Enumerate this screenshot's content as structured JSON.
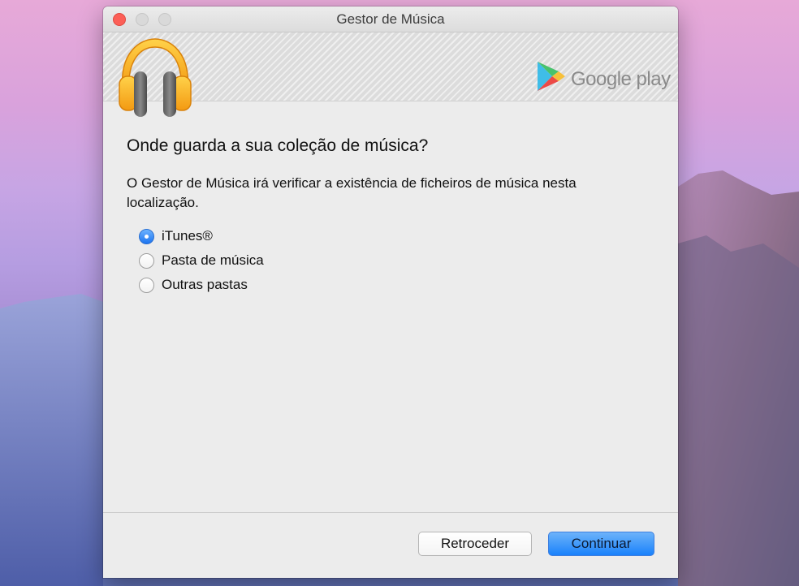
{
  "window": {
    "title": "Gestor de Música"
  },
  "banner": {
    "brand_text": "Google play",
    "app_icon": "headphones-icon",
    "brand_icon": "google-play-icon"
  },
  "content": {
    "heading": "Onde guarda a sua coleção de música?",
    "description": "O Gestor de Música irá verificar a existência de ficheiros de música nesta localização.",
    "options": [
      {
        "label": "iTunes®",
        "selected": true
      },
      {
        "label": "Pasta de música",
        "selected": false
      },
      {
        "label": "Outras pastas",
        "selected": false
      }
    ]
  },
  "footer": {
    "back_label": "Retroceder",
    "continue_label": "Continuar"
  },
  "colors": {
    "accent": "#1a82fb",
    "close_button": "#fc5f57"
  }
}
